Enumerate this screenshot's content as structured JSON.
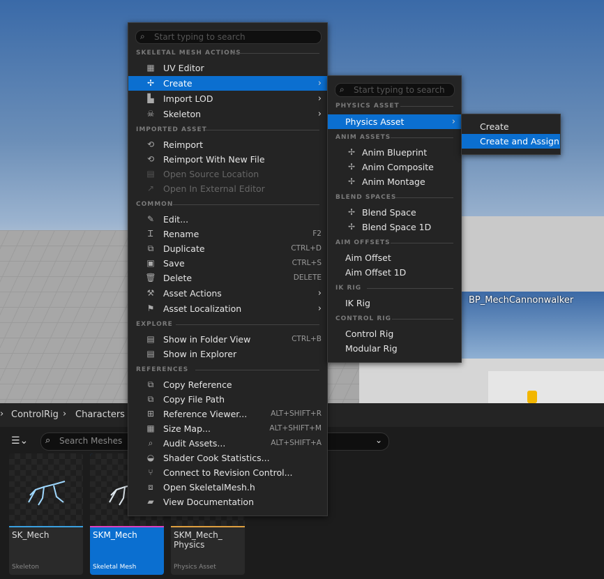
{
  "viewport": {
    "inset_title": "BP_MechCannonwalker"
  },
  "browser": {
    "breadcrumb": [
      "ControlRig",
      "Characters"
    ],
    "search_placeholder": "Search Meshes",
    "assets": [
      {
        "name": "SK_Mech",
        "type": "Skeleton",
        "bar_color": "#3aa0e0",
        "selected": false
      },
      {
        "name": "SKM_Mech",
        "type": "Skeletal Mesh",
        "bar_color": "#e040c0",
        "selected": true
      },
      {
        "name": "SKM_Mech_ Physics",
        "type": "Physics Asset",
        "bar_color": "#e0a040",
        "selected": false
      }
    ]
  },
  "menu": {
    "search_placeholder": "Start typing to search",
    "sections": {
      "skeletal": "SKELETAL MESH ACTIONS",
      "imported": "IMPORTED ASSET",
      "common": "COMMON",
      "explore": "EXPLORE",
      "references": "REFERENCES"
    },
    "items": {
      "uv_editor": "UV Editor",
      "create": "Create",
      "import_lod": "Import LOD",
      "skeleton": "Skeleton",
      "reimport": "Reimport",
      "reimport_new": "Reimport With New File",
      "open_source": "Open Source Location",
      "open_external": "Open In External Editor",
      "edit": "Edit...",
      "rename": "Rename",
      "duplicate": "Duplicate",
      "save": "Save",
      "delete": "Delete",
      "asset_actions": "Asset Actions",
      "asset_localization": "Asset Localization",
      "show_folder": "Show in Folder View",
      "show_explorer": "Show in Explorer",
      "copy_ref": "Copy Reference",
      "copy_path": "Copy File Path",
      "ref_viewer": "Reference Viewer...",
      "size_map": "Size Map...",
      "audit": "Audit Assets...",
      "shader_stats": "Shader Cook Statistics...",
      "revision": "Connect to Revision Control...",
      "open_header": "Open SkeletalMesh.h",
      "view_docs": "View Documentation"
    },
    "shortcuts": {
      "rename": "F2",
      "duplicate": "CTRL+D",
      "save": "CTRL+S",
      "delete": "DELETE",
      "show_folder": "CTRL+B",
      "ref_viewer": "ALT+SHIFT+R",
      "size_map": "ALT+SHIFT+M",
      "audit": "ALT+SHIFT+A"
    }
  },
  "submenu": {
    "search_placeholder": "Start typing to search",
    "sections": {
      "physics": "PHYSICS ASSET",
      "anim": "ANIM ASSETS",
      "blend": "BLEND SPACES",
      "aim": "AIM OFFSETS",
      "ik": "IK RIG",
      "control": "CONTROL RIG"
    },
    "items": {
      "physics_asset": "Physics Asset",
      "anim_blueprint": "Anim Blueprint",
      "anim_composite": "Anim Composite",
      "anim_montage": "Anim Montage",
      "blend_space": "Blend Space",
      "blend_space_1d": "Blend Space 1D",
      "aim_offset": "Aim Offset",
      "aim_offset_1d": "Aim Offset 1D",
      "ik_rig": "IK Rig",
      "control_rig": "Control Rig",
      "modular_rig": "Modular Rig"
    }
  },
  "submenu2": {
    "create": "Create",
    "create_assign": "Create and Assign"
  }
}
